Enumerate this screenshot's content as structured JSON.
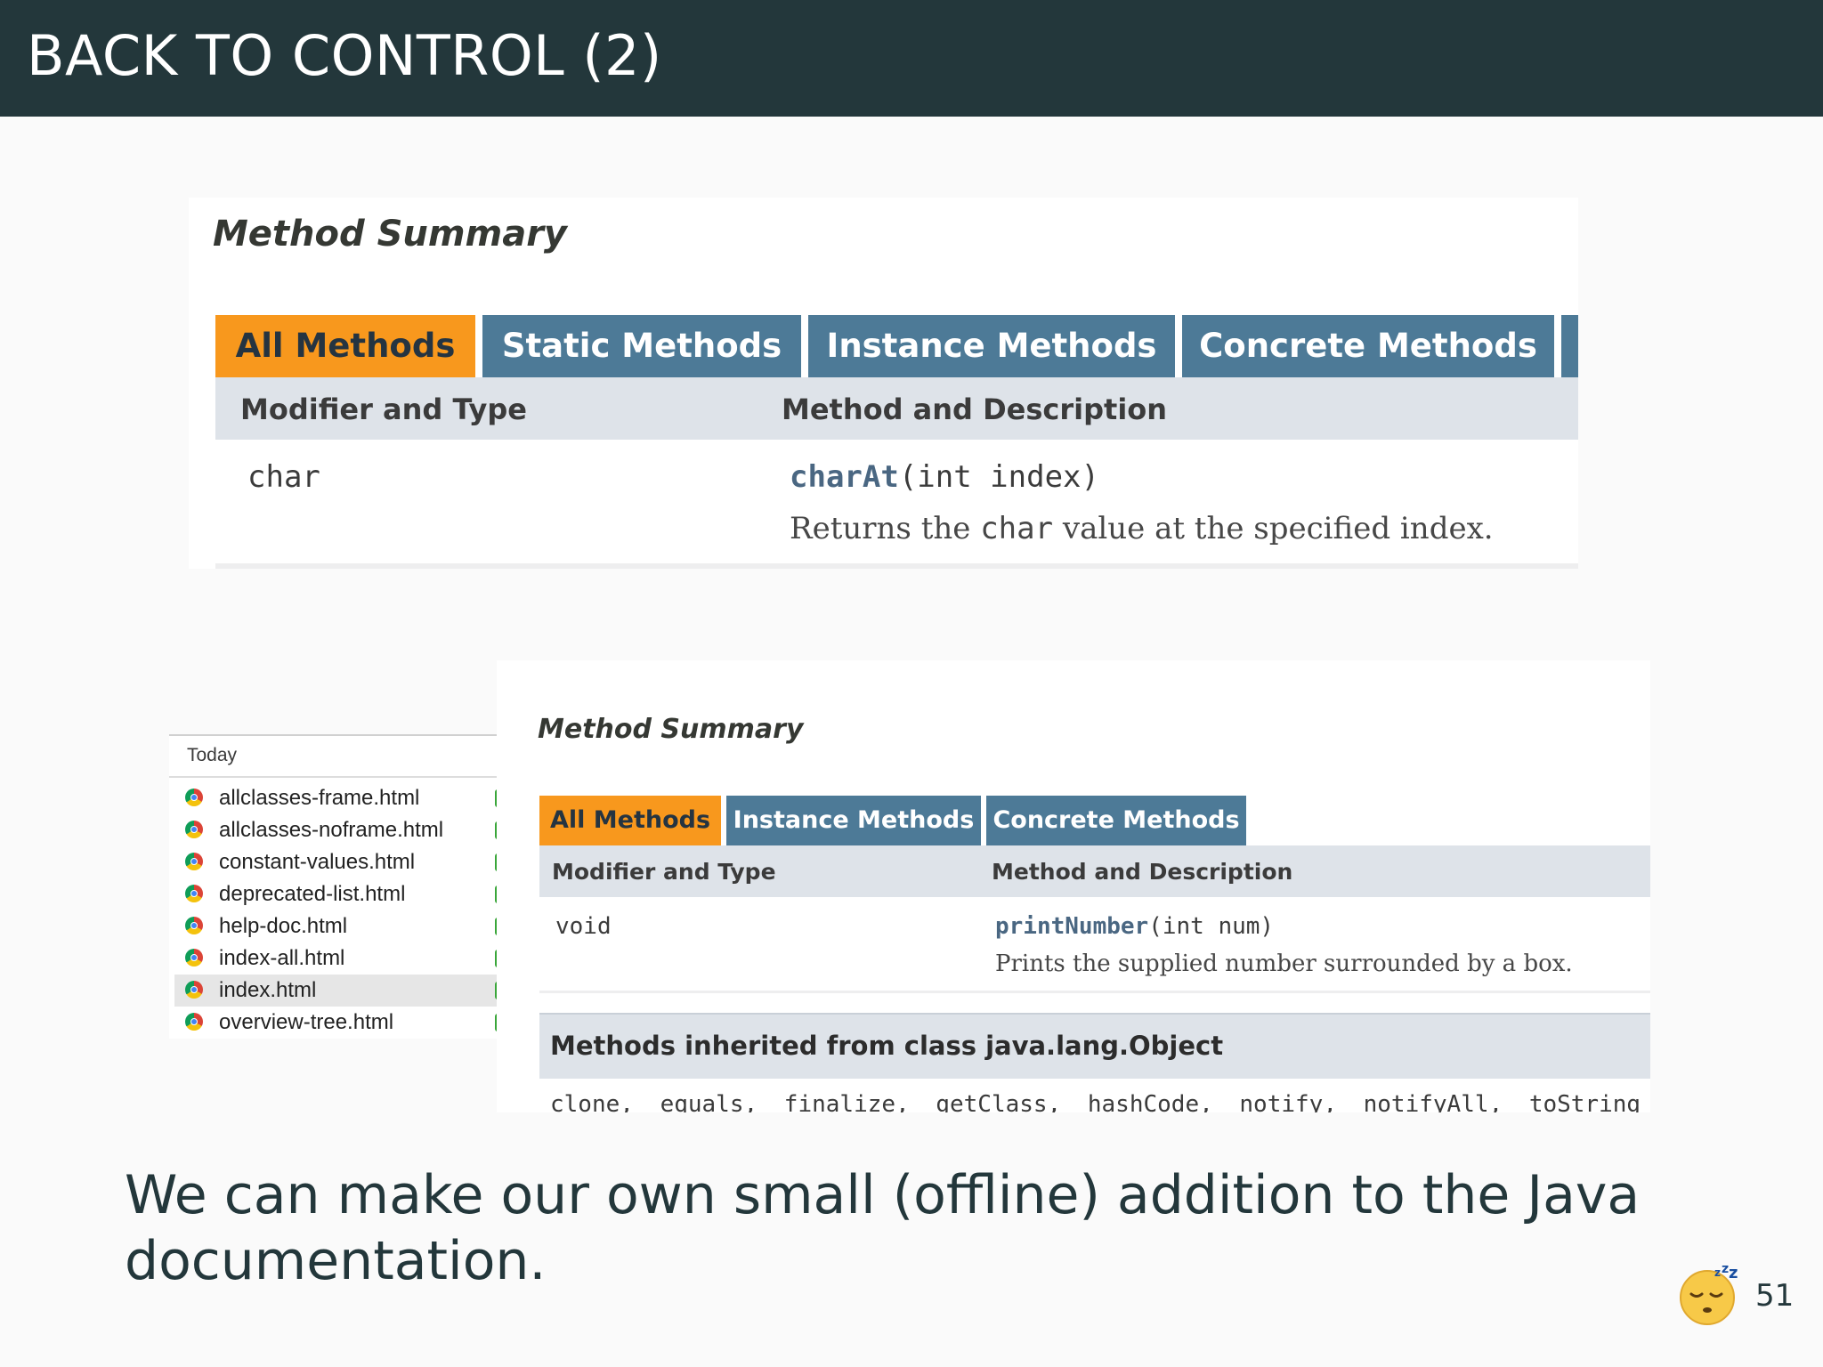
{
  "slide": {
    "title": "BACK TO CONTROL (2)",
    "caption": "We can make our own small (offline) addition to the Java documentation.",
    "page_number": "51"
  },
  "doc1": {
    "section_title": "Method Summary",
    "tabs": [
      "All Methods",
      "Static Methods",
      "Instance Methods",
      "Concrete Methods"
    ],
    "header": {
      "col1": "Modifier and Type",
      "col2": "Method and Description"
    },
    "row": {
      "type": "char",
      "method": "charAt",
      "params": "(int index)",
      "desc_pre": "Returns the ",
      "desc_code": "char",
      "desc_post": " value at the specified index."
    }
  },
  "finder": {
    "group_label": "Today",
    "files": [
      "allclasses-frame.html",
      "allclasses-noframe.html",
      "constant-values.html",
      "deprecated-list.html",
      "help-doc.html",
      "index-all.html",
      "index.html",
      "overview-tree.html"
    ],
    "selected": "index.html"
  },
  "doc2": {
    "section_title": "Method Summary",
    "tabs": [
      "All Methods",
      "Instance Methods",
      "Concrete Methods"
    ],
    "header": {
      "col1": "Modifier and Type",
      "col2": "Method and Description"
    },
    "row": {
      "type": "void",
      "method": "printNumber",
      "params": "(int num)",
      "desc": "Prints the supplied number surrounded by a box."
    },
    "inherited_title": "Methods inherited from class java.lang.Object",
    "inherited_methods": "clone, equals, finalize, getClass, hashCode, notify, notifyAll, toString"
  },
  "colors": {
    "title_bar": "#23373b",
    "tab_active": "#f8981d",
    "tab_inactive": "#4d7a97",
    "table_header": "#dee3e9"
  },
  "icons": {
    "status": "sleepy-emoji-icon",
    "file": "chrome-html-file-icon"
  }
}
